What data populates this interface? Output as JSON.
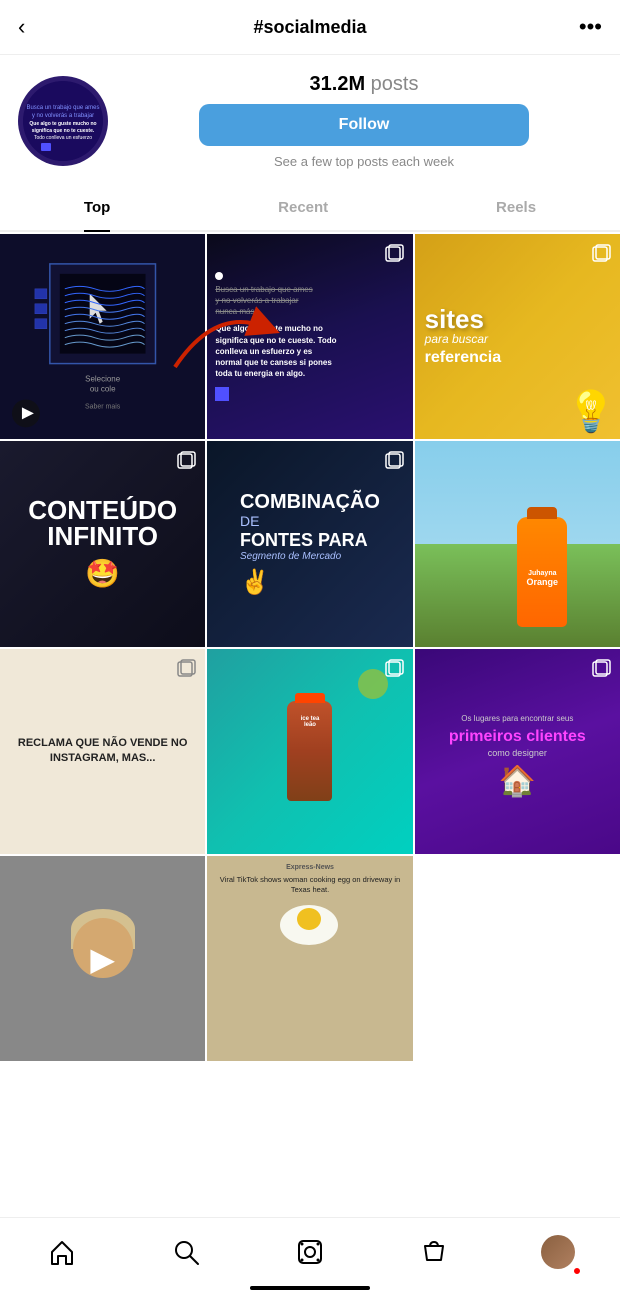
{
  "header": {
    "back_label": "‹",
    "title": "#socialmedia",
    "more_label": "•••"
  },
  "profile": {
    "posts_count": "31.2M",
    "posts_label": " posts",
    "follow_btn": "Follow",
    "see_posts_text": "See a few top posts each week"
  },
  "tabs": [
    {
      "label": "Top",
      "active": true
    },
    {
      "label": "Recent",
      "active": false
    },
    {
      "label": "Reels",
      "active": false
    }
  ],
  "grid": {
    "items": [
      {
        "id": 1,
        "type": "reel",
        "desc": "dark design screen"
      },
      {
        "id": 2,
        "type": "multi",
        "desc": "motivation text purple"
      },
      {
        "id": 3,
        "type": "multi",
        "desc": "sites para buscar referencia yellow"
      },
      {
        "id": 4,
        "type": "multi",
        "desc": "conteudo infinito dark"
      },
      {
        "id": 5,
        "type": "multi",
        "desc": "combinacao de fontes dark blue"
      },
      {
        "id": 6,
        "type": "multi",
        "desc": "juhayna orange bottle"
      },
      {
        "id": 7,
        "type": "multi",
        "desc": "reclama instagram text"
      },
      {
        "id": 8,
        "type": "multi",
        "desc": "ice tea leao bottle"
      },
      {
        "id": 9,
        "type": "multi",
        "desc": "primeiros clientes purple"
      },
      {
        "id": 10,
        "type": "video",
        "desc": "woman talking video"
      },
      {
        "id": 11,
        "type": "single",
        "desc": "viral tiktok egg news"
      }
    ]
  },
  "cell_texts": {
    "cell2_line1": "Busca un trabajo que ames",
    "cell2_line2": "y no volverás a trabajar",
    "cell2_line3": "nunca más.",
    "cell2_bold1": "Que algo te guste mucho no",
    "cell2_bold2": "significa que no te cueste. Todo",
    "cell2_bold3": "conlleva un esfuerzo y es",
    "cell2_bold4": "normal que te canses si pones",
    "cell2_bold5": "toda tu energia en algo.",
    "cell3_main": "sites",
    "cell3_sub": "para buscar",
    "cell3_sub2": "referencia",
    "cell4_main": "CONTEÚDO",
    "cell4_main2": "INFINITO",
    "cell4_emoji": "🤩",
    "cell5_main": "COMBINAÇÃO",
    "cell5_sub": "DE",
    "cell5_sub2": "FONTES PARA",
    "cell5_sub3": "Segmento de Mercado",
    "cell7_text": "RECLAMA QUE NÃO VENDE NO INSTAGRAM, MAS...",
    "cell8_brand": "Juhayna",
    "cell8_product": "Orange",
    "cell9_brand": "ice tea",
    "cell9_brand2": "leão",
    "cell10_title": "Os lugares para encontrar seus",
    "cell10_main": "primeiros clientes",
    "cell10_sub": "como designer",
    "cell12_header": "Express-News",
    "cell12_text": "Viral TikTok shows woman cooking egg on driveway in Texas heat."
  },
  "nav": {
    "home": "⌂",
    "search": "🔍",
    "reels": "📷",
    "shop": "🛍",
    "profile": "👤"
  }
}
